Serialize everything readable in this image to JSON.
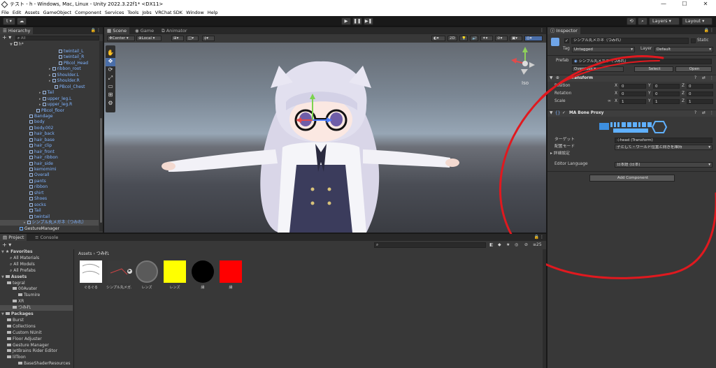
{
  "window": {
    "title": "テスト - h - Windows, Mac, Linux - Unity 2022.3.22f1* <DX11>",
    "min": "—",
    "max": "☐",
    "close": "✕"
  },
  "menu": [
    "File",
    "Edit",
    "Assets",
    "GameObject",
    "Component",
    "Services",
    "Tools",
    "Jobs",
    "VRChat SDK",
    "Window",
    "Help"
  ],
  "toolbar": {
    "account": "t",
    "play": "▶",
    "pause": "❚❚",
    "step": "▶❚",
    "layers": "Layers",
    "layout": "Layout"
  },
  "hierarchy": {
    "tab": "Hierarchy",
    "search_placeholder": "All",
    "scene": "h*",
    "items": [
      {
        "label": "twintail_L",
        "indent": 82,
        "blue": true
      },
      {
        "label": "twintail_R",
        "indent": 82,
        "blue": true
      },
      {
        "label": "PBcol_Head",
        "indent": 82,
        "blue": true
      },
      {
        "label": "ribbon_root",
        "indent": 70,
        "blue": true
      },
      {
        "label": "Shoulder.L",
        "indent": 70,
        "blue": true
      },
      {
        "label": "Shoulder.R",
        "indent": 70,
        "blue": true
      },
      {
        "label": "PBcol_Chest",
        "indent": 76,
        "blue": true
      },
      {
        "label": "Tail",
        "indent": 56,
        "blue": true
      },
      {
        "label": "upper_leg.L",
        "indent": 56,
        "blue": true
      },
      {
        "label": "upper_leg.R",
        "indent": 56,
        "blue": true
      },
      {
        "label": "PBcol_floor",
        "indent": 50,
        "blue": true
      },
      {
        "label": "Bandage",
        "indent": 40,
        "blue": true
      },
      {
        "label": "body",
        "indent": 40,
        "blue": true
      },
      {
        "label": "body.002",
        "indent": 40,
        "blue": true
      },
      {
        "label": "hair_back",
        "indent": 40,
        "blue": true
      },
      {
        "label": "hair_base",
        "indent": 40,
        "blue": true
      },
      {
        "label": "hair_clip",
        "indent": 40,
        "blue": true
      },
      {
        "label": "hair_front",
        "indent": 40,
        "blue": true
      },
      {
        "label": "hair_ribbon",
        "indent": 40,
        "blue": true
      },
      {
        "label": "hair_side",
        "indent": 40,
        "blue": true
      },
      {
        "label": "kemomimi",
        "indent": 40,
        "blue": true
      },
      {
        "label": "Overall",
        "indent": 40,
        "blue": true
      },
      {
        "label": "pants",
        "indent": 40,
        "blue": true
      },
      {
        "label": "ribbon",
        "indent": 40,
        "blue": true
      },
      {
        "label": "shirt",
        "indent": 40,
        "blue": true
      },
      {
        "label": "Shoes",
        "indent": 40,
        "blue": true
      },
      {
        "label": "socks",
        "indent": 40,
        "blue": true
      },
      {
        "label": "Tail",
        "indent": 40,
        "blue": true
      },
      {
        "label": "twintail",
        "indent": 40,
        "blue": true
      },
      {
        "label": "シンプル丸メガネ（つみれ）",
        "indent": 34,
        "blue": true,
        "selected": true
      },
      {
        "label": "GestureManager",
        "indent": 26,
        "blue": false
      }
    ]
  },
  "scene": {
    "tabs": [
      "Scene",
      "Game",
      "Animator"
    ],
    "pivot": "Center",
    "space": "Local",
    "mode_2d": "2D",
    "persp": "Iso"
  },
  "inspector": {
    "tab": "Inspector",
    "object_name": "シンプル丸メガネ（つみれ）",
    "static_label": "Static",
    "tag_label": "Tag",
    "tag_value": "Untagged",
    "layer_label": "Layer",
    "layer_value": "Default",
    "prefab_label": "Prefab",
    "prefab_value": "シンプル丸メガネ（つみれ）",
    "overrides": "Overrides",
    "select": "Select",
    "open": "Open",
    "transform_title": "Transform",
    "position_label": "Position",
    "rotation_label": "Rotation",
    "scale_label": "Scale",
    "pos": [
      "0",
      "0",
      "0"
    ],
    "rot": [
      "0",
      "0",
      "0"
    ],
    "scl": [
      "1",
      "1",
      "1"
    ],
    "axis": [
      "X",
      "Y",
      "Z"
    ],
    "component_title": "MA Bone Proxy",
    "logo_text": "Modular Avatar",
    "target_label": "ターゲット",
    "target_value": "head (Transform)",
    "mode_label": "配置モード",
    "mode_value": "子として・ワールド位置と向きを維持",
    "advanced_label": "詳細設定",
    "lang_label": "Editor Language",
    "lang_value": "日本語 (日本)",
    "add_component": "Add Component"
  },
  "project": {
    "tabs": [
      "Project",
      "Console"
    ],
    "tree": [
      {
        "label": "Favorites",
        "indent": 2,
        "bold": true,
        "icon": "star"
      },
      {
        "label": "All Materials",
        "indent": 14,
        "icon": "search"
      },
      {
        "label": "All Models",
        "indent": 14,
        "icon": "search"
      },
      {
        "label": "All Prefabs",
        "indent": 14,
        "icon": "search"
      },
      {
        "label": "Assets",
        "indent": 2,
        "bold": true,
        "icon": "folder"
      },
      {
        "label": "tegral",
        "indent": 10,
        "icon": "folder"
      },
      {
        "label": "00Avater",
        "indent": 18,
        "icon": "folder"
      },
      {
        "label": "Tsumire",
        "indent": 26,
        "icon": "folder"
      },
      {
        "label": "XR",
        "indent": 18,
        "icon": "folder"
      },
      {
        "label": "つみれ",
        "indent": 18,
        "icon": "folder",
        "selected": true
      },
      {
        "label": "Packages",
        "indent": 2,
        "bold": true,
        "icon": "folder"
      },
      {
        "label": "Burst",
        "indent": 10,
        "icon": "folder"
      },
      {
        "label": "Collections",
        "indent": 10,
        "icon": "folder"
      },
      {
        "label": "Custom NUnit",
        "indent": 10,
        "icon": "folder"
      },
      {
        "label": "Floor Adjuster",
        "indent": 10,
        "icon": "folder"
      },
      {
        "label": "Gesture Manager",
        "indent": 10,
        "icon": "folder"
      },
      {
        "label": "JetBrains Rider Editor",
        "indent": 10,
        "icon": "folder"
      },
      {
        "label": "lilToon",
        "indent": 10,
        "icon": "folder"
      },
      {
        "label": "BaseShaderResources",
        "indent": 26,
        "icon": "folder"
      }
    ],
    "breadcrumb": [
      "Assets",
      "つみれ"
    ],
    "zoom_count": "25",
    "assets": [
      {
        "label": "ぐるぐる",
        "type": "texture"
      },
      {
        "label": "シンプル丸メガ...",
        "type": "model"
      },
      {
        "label": "レンズ",
        "type": "lens"
      },
      {
        "label": "レンズ",
        "type": "yellow"
      },
      {
        "label": "縁",
        "type": "black"
      },
      {
        "label": "縁",
        "type": "red"
      }
    ],
    "swatch_colors": {
      "yellow": "#ffff00",
      "black": "#000000",
      "red": "#ff0000"
    }
  },
  "annotation": {
    "color": "#e0191f"
  }
}
